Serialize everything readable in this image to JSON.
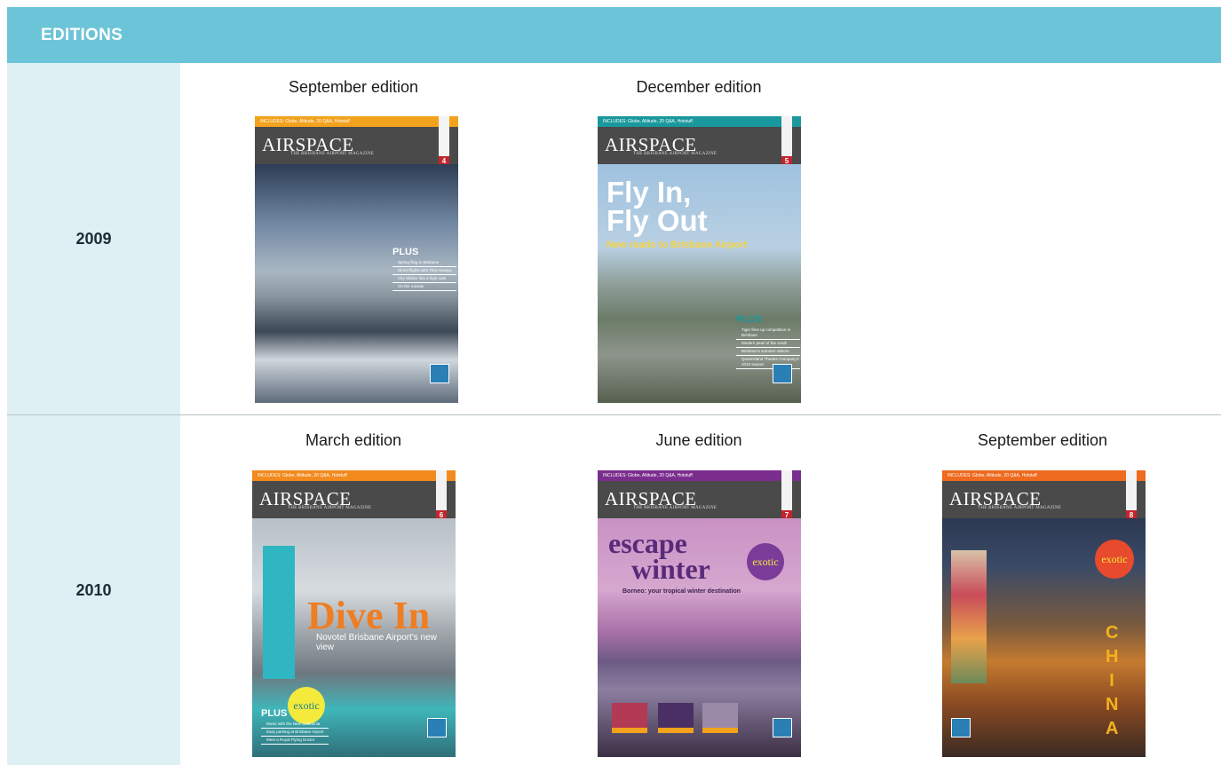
{
  "header": {
    "title": "EDITIONS"
  },
  "rows": [
    {
      "year": "2009",
      "editions": [
        {
          "title": "September edition",
          "cover": {
            "strip": "INCLUDES: Globe, Altitude, 20 Q&A, Hotstuff",
            "logo": "AIRSPACE",
            "logo_sub": "THE BRISBANE AIRPORT MAGAZINE",
            "issue": "4",
            "accent": "#f2a21c",
            "plus_title": "PLUS",
            "plus_items": [
              "Spring fling in Brisbane",
              "Direct flights with Thai Airways",
              "City Slicker hits a high note",
              "On the runway"
            ]
          }
        },
        {
          "title": "December edition",
          "cover": {
            "strip": "INCLUDES: Globe, Altitude, 20 Q&A, Hotstuff",
            "logo": "AIRSPACE",
            "logo_sub": "THE BRISBANE AIRPORT MAGAZINE",
            "issue": "5",
            "accent": "#19989d",
            "headline_1": "Fly In,",
            "headline_2": "Fly Out",
            "subhead": "New roads to Brisbane Airport",
            "plus_title": "PLUS",
            "plus_items": [
              "Tiger fires up competition in Brisbane",
              "Modern pearl of the south",
              "Brisbane's summer visitors",
              "Queensland Theatre Company's 2010 season"
            ]
          }
        }
      ]
    },
    {
      "year": "2010",
      "editions": [
        {
          "title": "March edition",
          "cover": {
            "strip": "INCLUDES: Globe, Altitude, 20 Q&A, Hotstuff",
            "logo": "AIRSPACE",
            "logo_sub": "THE BRISBANE AIRPORT MAGAZINE",
            "issue": "6",
            "accent": "#f28a1e",
            "headline_1": "Dive In",
            "subhead": "Novotel Brisbane Airport's new view",
            "sticker": "exotic",
            "plus_title": "PLUS",
            "plus_items": [
              "Music with the New Caledonia",
              "Easy parking at Brisbane Airport",
              "Meet a Royal Flying Doctor"
            ]
          }
        },
        {
          "title": "June edition",
          "cover": {
            "strip": "INCLUDES: Globe, Altitude, 20 Q&A, Hotstuff",
            "logo": "AIRSPACE",
            "logo_sub": "THE BRISBANE AIRPORT MAGAZINE",
            "issue": "7",
            "accent": "#7b2d8e",
            "headline_1": "escape",
            "headline_2": "winter",
            "subhead": "Borneo: your tropical winter destination",
            "sticker": "exotic"
          }
        },
        {
          "title": "September edition",
          "cover": {
            "strip": "INCLUDES: Globe, Altitude, 20 Q&A, Hotstuff",
            "logo": "AIRSPACE",
            "logo_sub": "THE BRISBANE AIRPORT MAGAZINE",
            "issue": "8",
            "accent": "#ee6a1f",
            "headline_1": "CHINA",
            "sticker": "exotic"
          }
        }
      ]
    }
  ]
}
